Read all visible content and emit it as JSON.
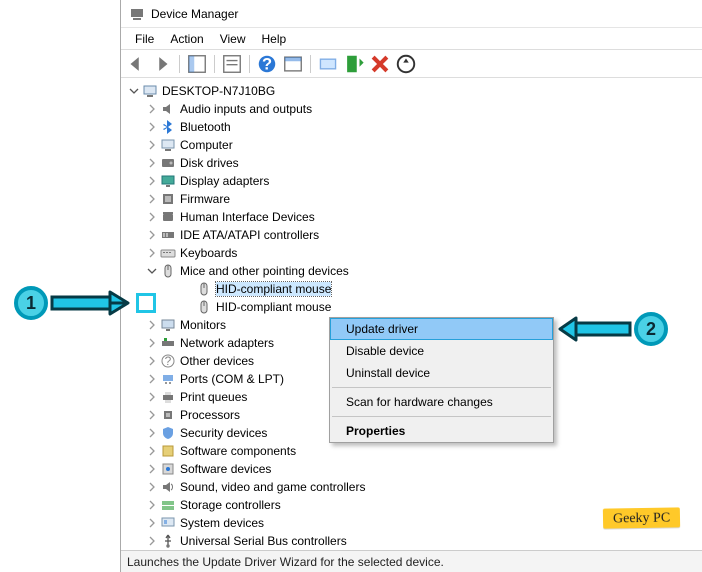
{
  "window": {
    "title": "Device Manager"
  },
  "menu": {
    "items": [
      "File",
      "Action",
      "View",
      "Help"
    ]
  },
  "toolbar_icons": [
    "back",
    "forward",
    "up-tree",
    "properties",
    "help",
    "show-hidden",
    "scan",
    "add-legacy",
    "remove",
    "update"
  ],
  "tree": {
    "root": {
      "label": "DESKTOP-N7J10BG",
      "expanded": true
    },
    "categories": [
      {
        "label": "Audio inputs and outputs",
        "icon": "audio",
        "state": "collapsed"
      },
      {
        "label": "Bluetooth",
        "icon": "bluetooth",
        "state": "collapsed"
      },
      {
        "label": "Computer",
        "icon": "computer",
        "state": "collapsed"
      },
      {
        "label": "Disk drives",
        "icon": "disk",
        "state": "collapsed"
      },
      {
        "label": "Display adapters",
        "icon": "display",
        "state": "collapsed"
      },
      {
        "label": "Firmware",
        "icon": "firmware",
        "state": "collapsed"
      },
      {
        "label": "Human Interface Devices",
        "icon": "hid",
        "state": "collapsed"
      },
      {
        "label": "IDE ATA/ATAPI controllers",
        "icon": "ide",
        "state": "collapsed"
      },
      {
        "label": "Keyboards",
        "icon": "keyboard",
        "state": "collapsed"
      },
      {
        "label": "Mice and other pointing devices",
        "icon": "mouse",
        "state": "expanded",
        "children": [
          {
            "label": "HID-compliant mouse",
            "icon": "mouse",
            "selected": true
          },
          {
            "label": "HID-compliant mouse",
            "icon": "mouse"
          }
        ]
      },
      {
        "label": "Monitors",
        "icon": "monitor",
        "state": "collapsed"
      },
      {
        "label": "Network adapters",
        "icon": "network",
        "state": "collapsed"
      },
      {
        "label": "Other devices",
        "icon": "other",
        "state": "collapsed"
      },
      {
        "label": "Ports (COM & LPT)",
        "icon": "port",
        "state": "collapsed"
      },
      {
        "label": "Print queues",
        "icon": "print",
        "state": "collapsed"
      },
      {
        "label": "Processors",
        "icon": "cpu",
        "state": "collapsed"
      },
      {
        "label": "Security devices",
        "icon": "security",
        "state": "collapsed"
      },
      {
        "label": "Software components",
        "icon": "swcomp",
        "state": "collapsed"
      },
      {
        "label": "Software devices",
        "icon": "swdev",
        "state": "collapsed"
      },
      {
        "label": "Sound, video and game controllers",
        "icon": "sound",
        "state": "collapsed"
      },
      {
        "label": "Storage controllers",
        "icon": "storage",
        "state": "collapsed"
      },
      {
        "label": "System devices",
        "icon": "system",
        "state": "collapsed"
      },
      {
        "label": "Universal Serial Bus controllers",
        "icon": "usb",
        "state": "collapsed"
      }
    ]
  },
  "context_menu": {
    "items": [
      {
        "label": "Update driver",
        "highlighted": true
      },
      {
        "label": "Disable device"
      },
      {
        "label": "Uninstall device"
      },
      {
        "sep": true
      },
      {
        "label": "Scan for hardware changes"
      },
      {
        "sep": true
      },
      {
        "label": "Properties",
        "bold": true
      }
    ]
  },
  "statusbar": {
    "text": "Launches the Update Driver Wizard for the selected device."
  },
  "annotations": {
    "step1": "1",
    "step2": "2"
  },
  "watermark": "Geeky PC"
}
